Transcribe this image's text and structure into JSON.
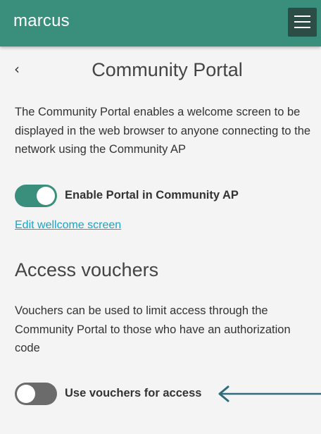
{
  "header": {
    "app_title": "marcus",
    "menu_icon": "hamburger-menu-icon",
    "color": "#3a8f7c"
  },
  "page": {
    "back_glyph": "‹",
    "title": "Community Portal"
  },
  "portal": {
    "description": "The Community Portal enables a welcome screen to be displayed in the web browser to anyone connecting to the network using the Community AP",
    "toggle_label": "Enable Portal in Community AP",
    "toggle_on": true,
    "edit_link": "Edit wellcome screen"
  },
  "vouchers": {
    "heading": "Access vouchers",
    "description": "Vouchers can be used to limit access through the Community Portal to those who have an authorization code",
    "toggle_label": "Use vouchers for access",
    "toggle_on": false
  },
  "annotation": {
    "arrow_icon": "left-arrow-icon",
    "arrow_color": "#2e6b7e"
  }
}
